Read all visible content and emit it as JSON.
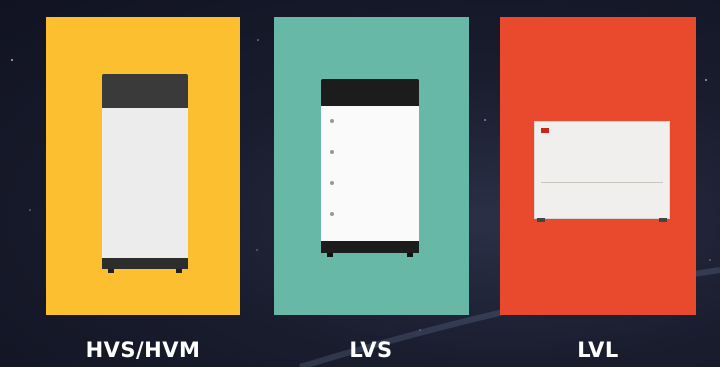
{
  "products": [
    {
      "label": "HVS/HVM",
      "color": "#fcbf2f"
    },
    {
      "label": "LVS",
      "color": "#67b8a6"
    },
    {
      "label": "LVL",
      "color": "#e94a2d"
    }
  ]
}
